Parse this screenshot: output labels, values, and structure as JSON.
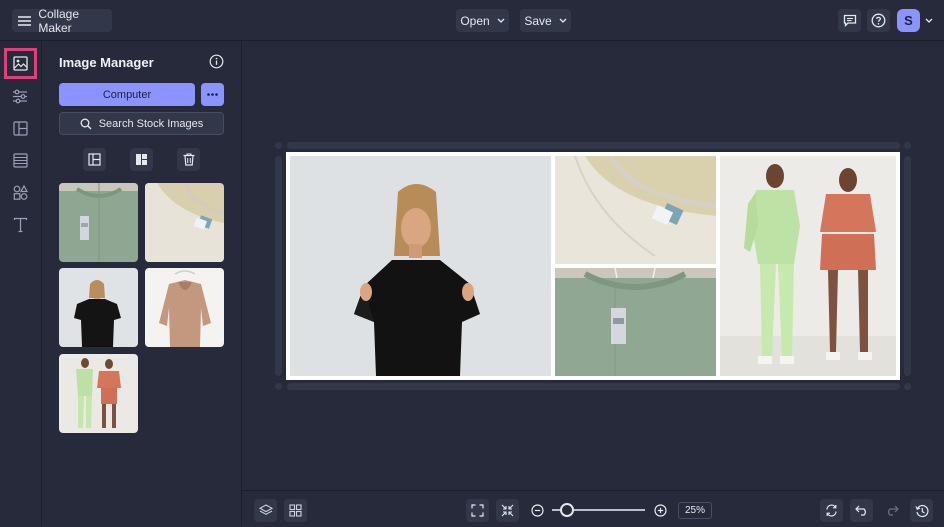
{
  "app": {
    "title": "Collage Maker"
  },
  "header": {
    "open_label": "Open",
    "save_label": "Save",
    "avatar_initial": "S"
  },
  "rail": {
    "items": [
      {
        "icon": "image-icon",
        "active": true
      },
      {
        "icon": "sliders-icon"
      },
      {
        "icon": "layout-icon"
      },
      {
        "icon": "texture-icon"
      },
      {
        "icon": "graphics-icon"
      },
      {
        "icon": "text-icon"
      }
    ]
  },
  "panel": {
    "title": "Image Manager",
    "computer_label": "Computer",
    "stock_label": "Search Stock Images"
  },
  "zoom": {
    "value": "25%",
    "level": 0.1
  },
  "colors": {
    "accent": "#8b93ff",
    "active_outline": "#e0407a",
    "background": "#262a3b",
    "button_bg": "#323749"
  }
}
